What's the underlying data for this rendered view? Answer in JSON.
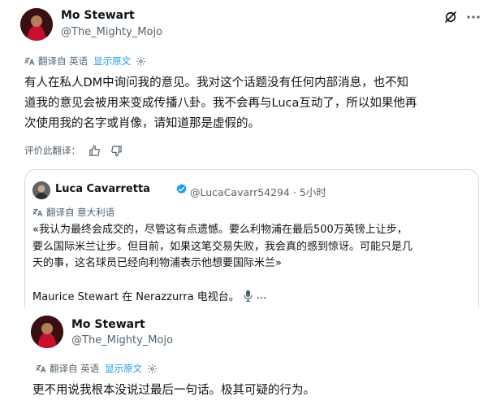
{
  "tweet1": {
    "author": {
      "name": "Mo Stewart",
      "handle": "@The_Mighty_Mojo"
    },
    "translation": {
      "label": "翻译自 英语",
      "show_original": "显示原文"
    },
    "lines": [
      "有人在私人DM中询问我的意见。我对这个话题没有任何内部消息，也不知",
      "道我的意见会被用来变成传播八卦。我不会再与Luca互动了，所以如果他再",
      "次使用我的名字或肖像，请知道那是虚假的。"
    ],
    "rate_label": "评价此翻译："
  },
  "quote": {
    "author": {
      "name": "Luca Cavarretta",
      "handle": "@LucaCavarr54294",
      "time": "5小时"
    },
    "translation": {
      "label": "翻译自 意大利语"
    },
    "lines": [
      "«我认为最终会成交的，尽管这有点遗憾。要么利物浦在最后500万英镑上让步，",
      "要么国际米兰让步。但目前，如果这笔交易失败，我会真的感到惊讶。可能只是几",
      "天的事，这名球员已经向利物浦表示他想要国际米兰»"
    ],
    "footer": "Maurice Stewart 在 Nerazzurra 电视台。",
    "ellipsis": "..."
  },
  "tweet2": {
    "author": {
      "name": "Mo Stewart",
      "handle": "@The_Mighty_Mojo"
    },
    "translation": {
      "label": "翻译自 英语",
      "show_original": "显示原文"
    },
    "text": "更不用说我根本没说过最后一句话。极其可疑的行为。"
  },
  "colors": {
    "accent": "#1d9bf0",
    "secondary_text": "#536471",
    "border": "#cfd9de"
  },
  "icons": [
    "grok-icon",
    "translate-icon",
    "gear-icon",
    "thumbs-up-icon",
    "thumbs-down-icon",
    "verified-badge-icon",
    "microphone-icon"
  ]
}
